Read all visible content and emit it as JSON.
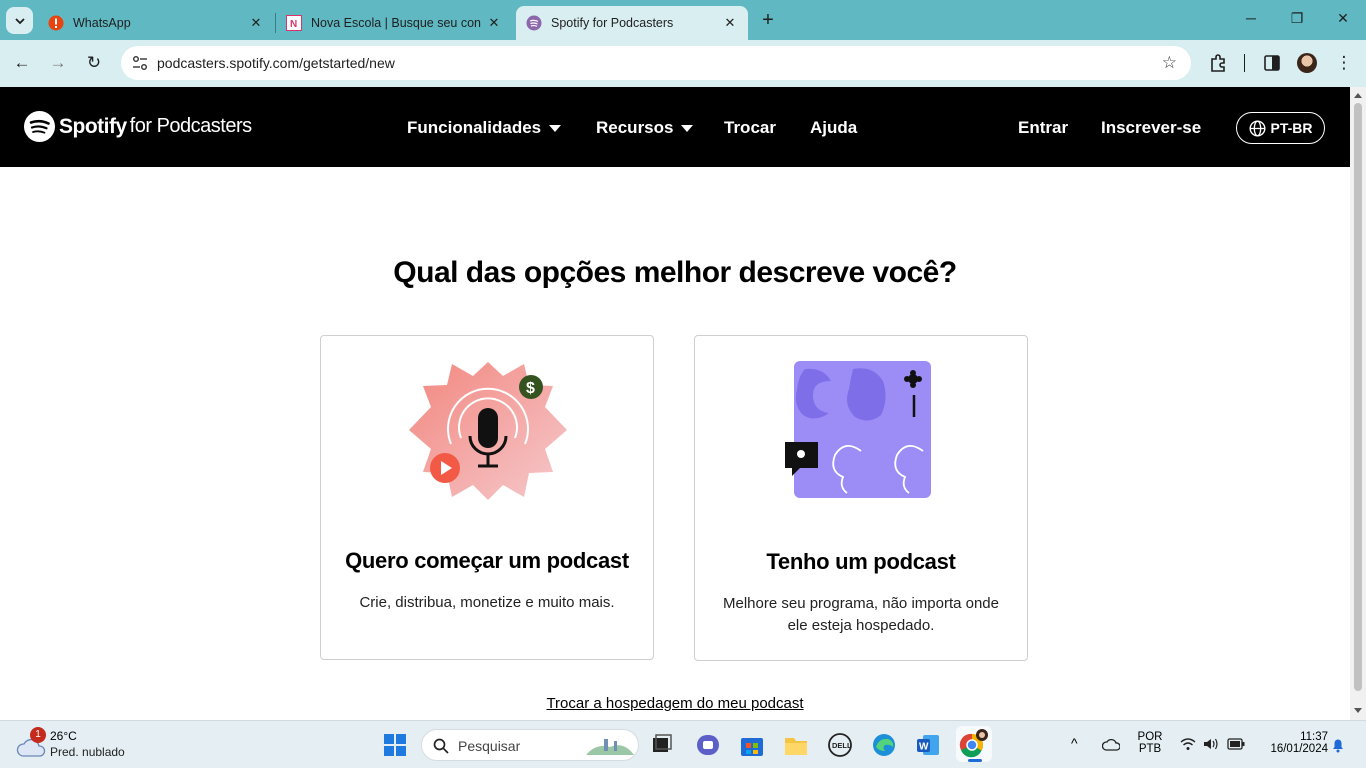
{
  "browser": {
    "tabs": [
      {
        "title": "WhatsApp"
      },
      {
        "title": "Nova Escola | Busque seu conte"
      },
      {
        "title": "Spotify for Podcasters"
      }
    ],
    "url": "podcasters.spotify.com/getstarted/new"
  },
  "header": {
    "logo_word": "Spotify",
    "logo_sub": "for Podcasters",
    "nav": [
      "Funcionalidades",
      "Recursos",
      "Trocar",
      "Ajuda"
    ],
    "login": "Entrar",
    "signup": "Inscrever-se",
    "language": "PT-BR"
  },
  "main": {
    "headline": "Qual das opções melhor descreve você?",
    "cards": [
      {
        "title": "Quero começar um podcast",
        "description": "Crie, distribua, monetize e muito mais."
      },
      {
        "title": "Tenho um podcast",
        "description": "Melhore seu programa, não importa onde ele esteja hospedado."
      }
    ],
    "transfer_link": "Trocar a hospedagem do meu podcast"
  },
  "taskbar": {
    "weather_badge": "1",
    "temperature": "26°C",
    "condition": "Pred. nublado",
    "search_placeholder": "Pesquisar",
    "lang_top": "POR",
    "lang_bottom": "PTB",
    "time": "11:37",
    "date": "16/01/2024"
  },
  "colors": {
    "tabbar": "#5fb8c2",
    "toolbar": "#d8eef1",
    "spotify_header": "#000000",
    "card_border": "#cfcfcf",
    "quote_art": "#9c8df6",
    "mic_art": "#f3a6a0"
  }
}
